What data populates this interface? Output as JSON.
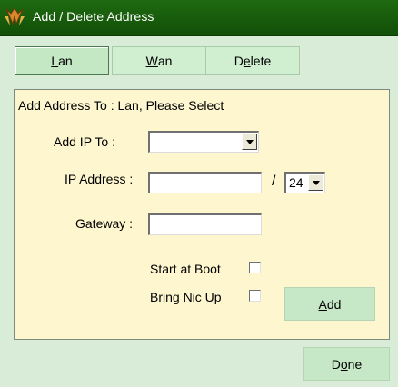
{
  "window": {
    "title": "Add / Delete Address"
  },
  "tabs": [
    {
      "prefix": "",
      "mnemonic": "L",
      "suffix": "an",
      "active": true
    },
    {
      "prefix": "",
      "mnemonic": "W",
      "suffix": "an",
      "active": false
    },
    {
      "prefix": "D",
      "mnemonic": "e",
      "suffix": "lete",
      "active": false
    }
  ],
  "form": {
    "heading": "Add Address To :  Lan, Please Select",
    "add_ip_to_label": "Add IP To :",
    "add_ip_to_value": "",
    "ip_address_label": "IP Address :",
    "ip_address_value": "",
    "slash": "/",
    "netmask_value": "24",
    "gateway_label": "Gateway :",
    "gateway_value": "",
    "start_at_boot_label": "Start at Boot",
    "start_at_boot_checked": false,
    "bring_nic_up_label": "Bring Nic Up",
    "bring_nic_up_checked": false,
    "add_button": {
      "mnemonic": "A",
      "suffix": "dd"
    }
  },
  "footer": {
    "done_button": {
      "prefix": "D",
      "mnemonic": "o",
      "suffix": "ne"
    }
  },
  "colors": {
    "titlebar": "#1f6a10",
    "window_bg": "#d8ecd8",
    "panel_bg": "#fdf6cf",
    "button_bg": "#c6e8c6"
  },
  "icons": {
    "title": "app-logo-icon"
  }
}
